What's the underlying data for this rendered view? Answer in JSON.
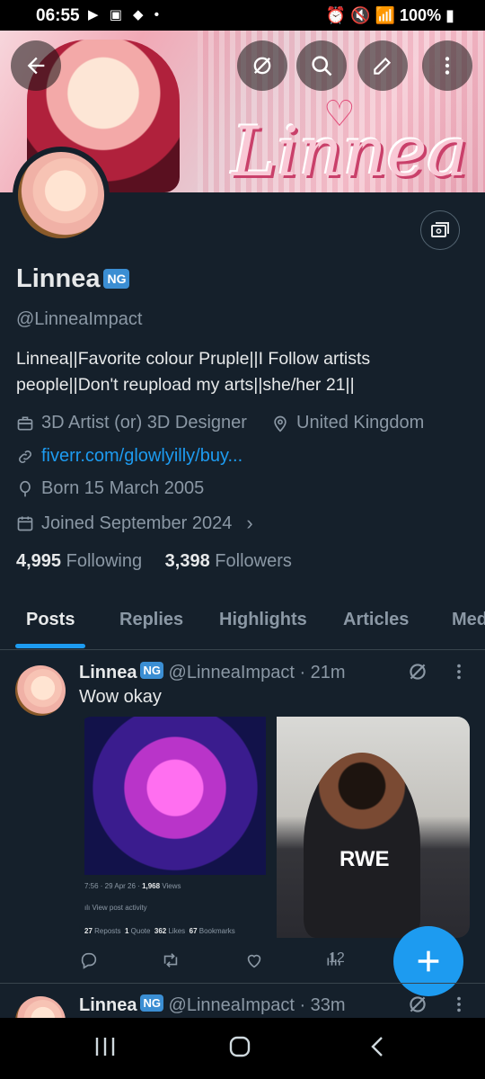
{
  "status_bar": {
    "time": "06:55",
    "battery": "100%"
  },
  "profile": {
    "name": "Linnea",
    "badge": "NG",
    "handle": "@LinneaImpact",
    "bio": "Linnea||Favorite colour Pruple||I Follow artists people||Don't reupload my arts||she/her 21||",
    "profession": "3D Artist (or) 3D Designer",
    "location": "United Kingdom",
    "website": "fiverr.com/glowlyilly/buy...",
    "born": "Born 15 March 2005",
    "joined": "Joined September 2024",
    "following_count": "4,995",
    "following_label": "Following",
    "followers_count": "3,398",
    "followers_label": "Followers",
    "banner_text": "Linnea"
  },
  "tabs": [
    "Posts",
    "Replies",
    "Highlights",
    "Articles",
    "Med"
  ],
  "posts": [
    {
      "name": "Linnea",
      "badge": "NG",
      "handle_time": "@LinneaImpact · 21m",
      "text": "Wow okay",
      "embedded": {
        "time_line": "7:56 · 29 Apr 26 ·",
        "views_count": "1,968",
        "views_label": "Views",
        "activity": "View post activity",
        "reposts_count": "27",
        "reposts_label": "Reposts",
        "quote_count": "1",
        "quote_label": "Quote",
        "likes_count": "362",
        "likes_label": "Likes",
        "bookmarks_count": "67",
        "bookmarks_label": "Bookmarks"
      },
      "video_text": "RWE",
      "views": "12"
    },
    {
      "name": "Linnea",
      "badge": "NG",
      "handle_time": "@LinneaImpact · 33m"
    }
  ],
  "colors": {
    "accent": "#1d9bf0",
    "background": "#15202b",
    "muted": "#8b98a5"
  }
}
